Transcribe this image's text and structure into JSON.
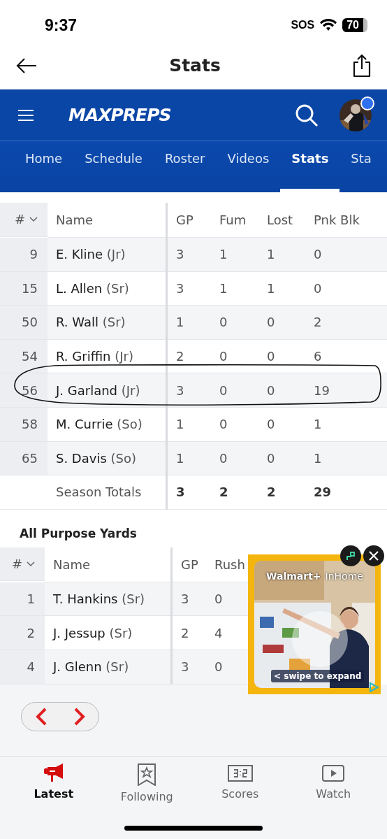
{
  "status_bar": {
    "time": "9:37",
    "carrier": "SOS",
    "battery": "70"
  },
  "header": {
    "title": "Stats"
  },
  "brand": {
    "logo": "MAXPREPS"
  },
  "tabs": [
    {
      "label": "Home",
      "selected": false
    },
    {
      "label": "Schedule",
      "selected": false
    },
    {
      "label": "Roster",
      "selected": false
    },
    {
      "label": "Videos",
      "selected": false
    },
    {
      "label": "Stats",
      "selected": true
    },
    {
      "label": "Sta",
      "selected": false
    }
  ],
  "table": {
    "columns": [
      "#",
      "Name",
      "GP",
      "Fum",
      "Lost",
      "Pnk Blk"
    ],
    "rows": [
      {
        "number": "9",
        "name": "**E. Kline** (Jr)",
        "values": [
          "3",
          "1",
          "1",
          "0"
        ]
      },
      {
        "number": "15",
        "name": "**L. Allen** (Sr)",
        "values": [
          "3",
          "1",
          "1",
          "0"
        ]
      },
      {
        "number": "50",
        "name": "**R. Wall** (Sr)",
        "values": [
          "1",
          "0",
          "0",
          "2"
        ]
      },
      {
        "number": "54",
        "name": "**R. Griffin** (Jr)",
        "values": [
          "2",
          "0",
          "0",
          "6"
        ]
      },
      {
        "number": "56",
        "name": "**J. Garland** (Jr)",
        "values": [
          "3",
          "0",
          "0",
          "19"
        ]
      },
      {
        "number": "58",
        "name": "**M. Currie** (So)",
        "values": [
          "1",
          "0",
          "0",
          "1"
        ]
      },
      {
        "number": "65",
        "name": "**S. Davis** (So)",
        "values": [
          "1",
          "0",
          "0",
          "1"
        ]
      }
    ],
    "totals": {
      "label": "Season Totals",
      "values": [
        "3",
        "2",
        "2",
        "29"
      ]
    }
  },
  "yards": {
    "title": "All Purpose Yards",
    "columns": [
      "#",
      "Name",
      "GP",
      "Rush"
    ],
    "rows": [
      {
        "number": "1",
        "name": "**T. Hankins** (Sr)",
        "values": [
          "3",
          "0"
        ]
      },
      {
        "number": "2",
        "name": "**J. Jessup** (Sr)",
        "values": [
          "2",
          "4"
        ]
      },
      {
        "number": "4",
        "name": "**J. Glenn** (Sr)",
        "values": [
          "3",
          "0"
        ]
      }
    ]
  },
  "ad": {
    "brand": "Walmart+",
    "product": "InHome",
    "hint": "< swipe to expand"
  },
  "bottom_nav": [
    {
      "label": "Latest",
      "selected": true,
      "kind": "megaphone"
    },
    {
      "label": "Following",
      "selected": false,
      "kind": "bookmark"
    },
    {
      "label": "Scores",
      "selected": false,
      "kind": "scoreboard"
    },
    {
      "label": "Watch",
      "selected": false,
      "kind": "play"
    }
  ]
}
